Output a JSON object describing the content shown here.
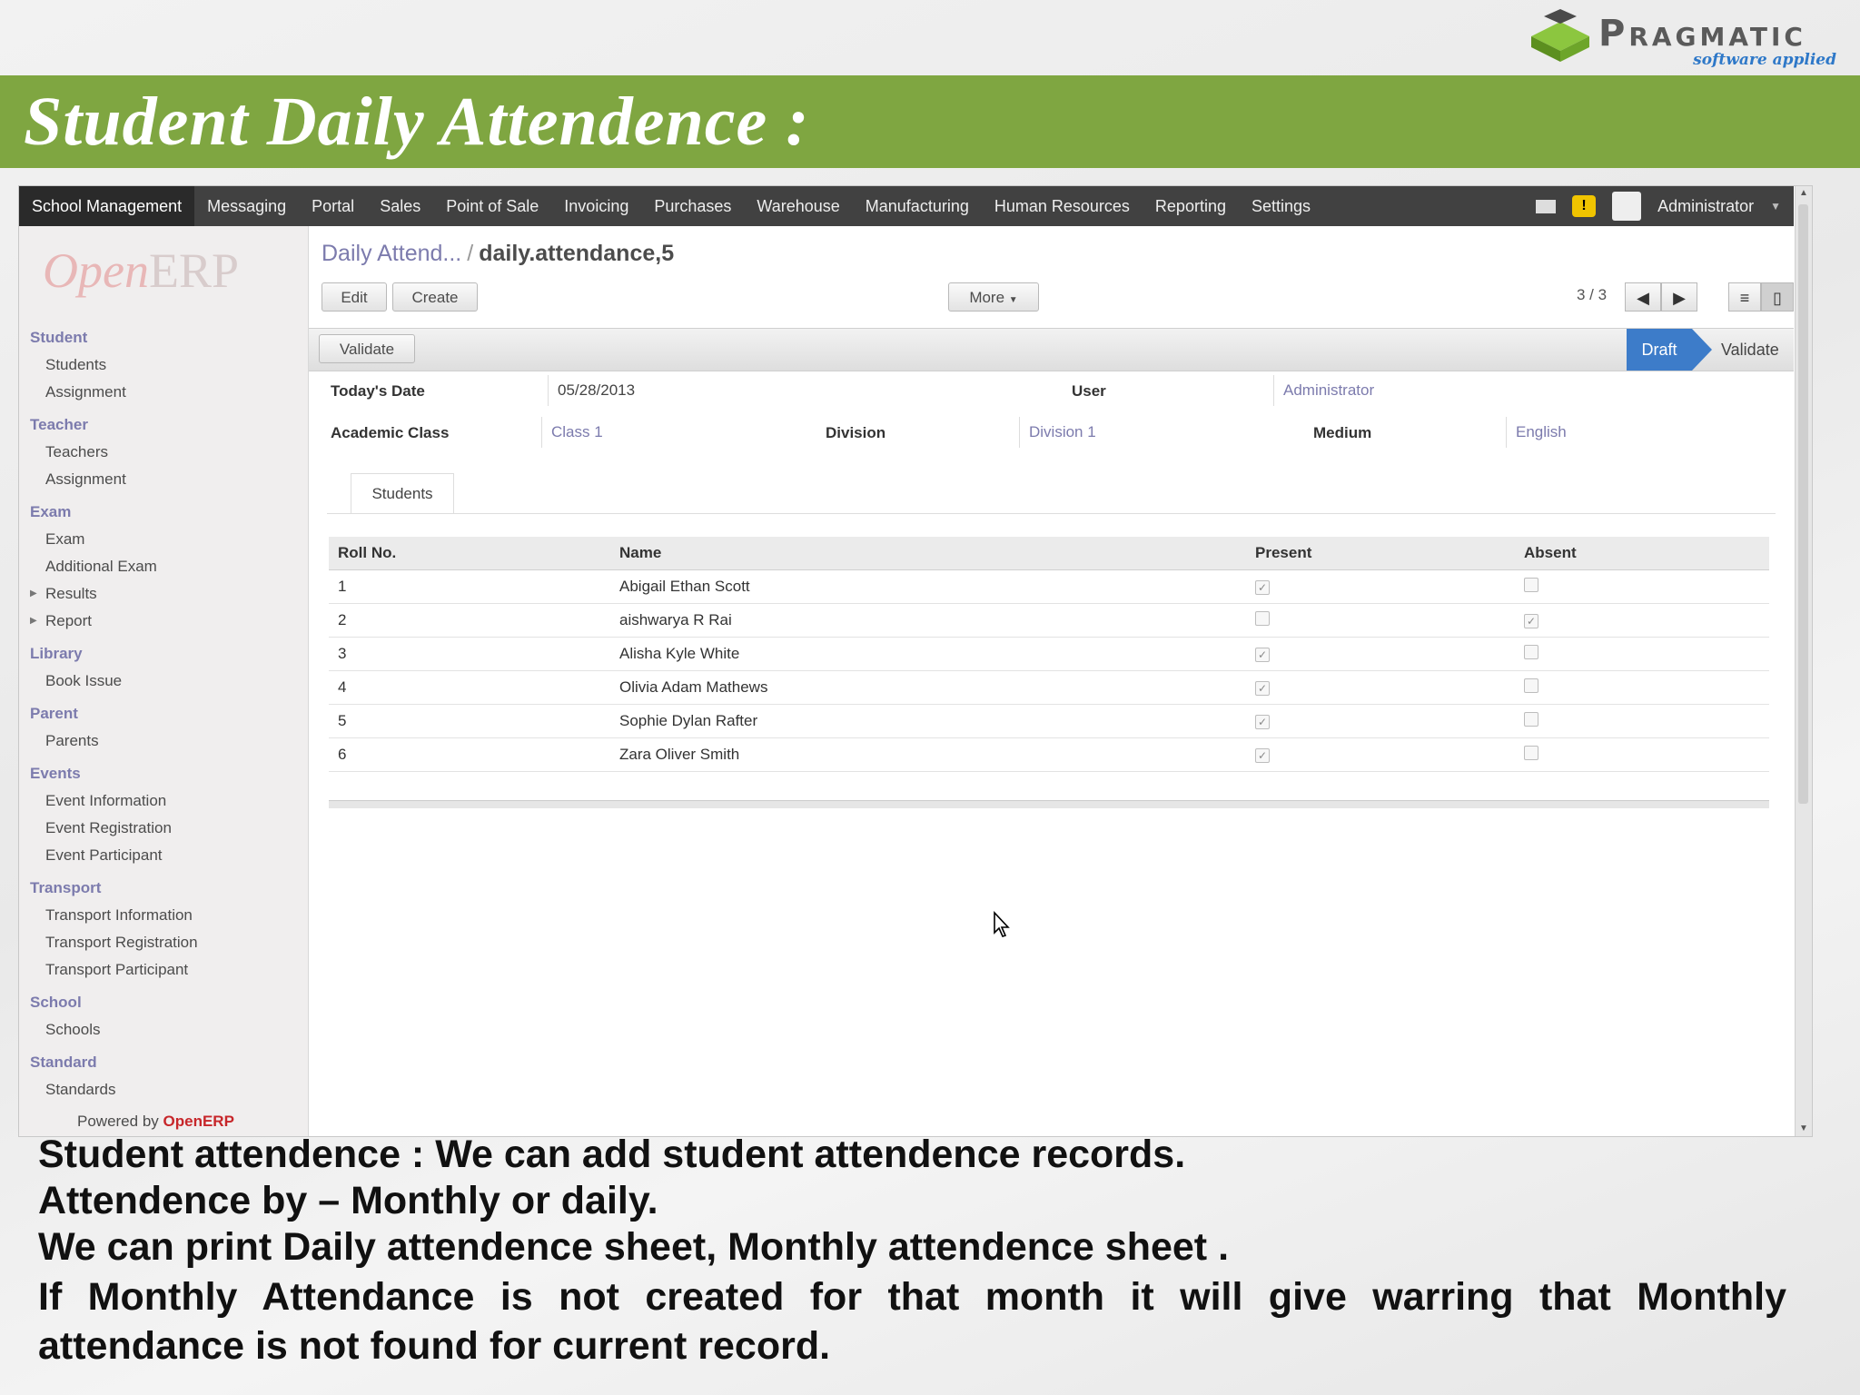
{
  "logo": {
    "brand": "Pragmatic",
    "tagline": "software applied"
  },
  "title": "Student Daily Attendence :",
  "topbar": {
    "menu": [
      "School Management",
      "Messaging",
      "Portal",
      "Sales",
      "Point of Sale",
      "Invoicing",
      "Purchases",
      "Warehouse",
      "Manufacturing",
      "Human Resources",
      "Reporting",
      "Settings"
    ],
    "user": "Administrator"
  },
  "sidebar": {
    "logo": "OpenERP",
    "sections": [
      {
        "title": "Student",
        "items": [
          "Students",
          "Assignment"
        ]
      },
      {
        "title": "Teacher",
        "items": [
          "Teachers",
          "Assignment"
        ]
      },
      {
        "title": "Exam",
        "items": [
          "Exam",
          "Additional Exam",
          "Results",
          "Report"
        ]
      },
      {
        "title": "Library",
        "items": [
          "Book Issue"
        ]
      },
      {
        "title": "Parent",
        "items": [
          "Parents"
        ]
      },
      {
        "title": "Events",
        "items": [
          "Event Information",
          "Event Registration",
          "Event Participant"
        ]
      },
      {
        "title": "Transport",
        "items": [
          "Transport Information",
          "Transport Registration",
          "Transport Participant"
        ]
      },
      {
        "title": "School",
        "items": [
          "Schools"
        ]
      },
      {
        "title": "Standard",
        "items": [
          "Standards"
        ]
      }
    ],
    "powered_by": "Powered by",
    "powered_brand": "OpenERP"
  },
  "breadcrumb": {
    "parent": "Daily Attend...",
    "separator": "/",
    "current": "daily.attendance,5"
  },
  "buttons": {
    "edit": "Edit",
    "create": "Create",
    "more": "More",
    "validate": "Validate"
  },
  "pager": "3 / 3",
  "stages": {
    "draft": "Draft",
    "validate": "Validate"
  },
  "form": {
    "todays_date_label": "Today's Date",
    "todays_date": "05/28/2013",
    "user_label": "User",
    "user": "Administrator",
    "academic_class_label": "Academic Class",
    "academic_class": "Class 1",
    "division_label": "Division",
    "division": "Division 1",
    "medium_label": "Medium",
    "medium": "English"
  },
  "tab": "Students",
  "table": {
    "headers": [
      "Roll No.",
      "Name",
      "Present",
      "Absent"
    ],
    "rows": [
      {
        "roll": "1",
        "name": "Abigail Ethan Scott",
        "present": true,
        "absent": false
      },
      {
        "roll": "2",
        "name": "aishwarya R Rai",
        "present": false,
        "absent": true
      },
      {
        "roll": "3",
        "name": "Alisha Kyle White",
        "present": true,
        "absent": false
      },
      {
        "roll": "4",
        "name": "Olivia Adam Mathews",
        "present": true,
        "absent": false
      },
      {
        "roll": "5",
        "name": "Sophie Dylan Rafter",
        "present": true,
        "absent": false
      },
      {
        "roll": "6",
        "name": "Zara Oliver Smith",
        "present": true,
        "absent": false
      }
    ]
  },
  "notes": [
    "Student attendence : We can add student attendence records.",
    "Attendence by – Monthly or daily.",
    "We can print Daily attendence sheet, Monthly attendence sheet .",
    "If Monthly Attendance is not created for that month it will give warring that Monthly",
    "attendance is not found for current record."
  ],
  "colors": {
    "banner": "#7fa641",
    "accent": "#7c7bad",
    "draft": "#3d7cc9",
    "topbar": "#414141"
  }
}
